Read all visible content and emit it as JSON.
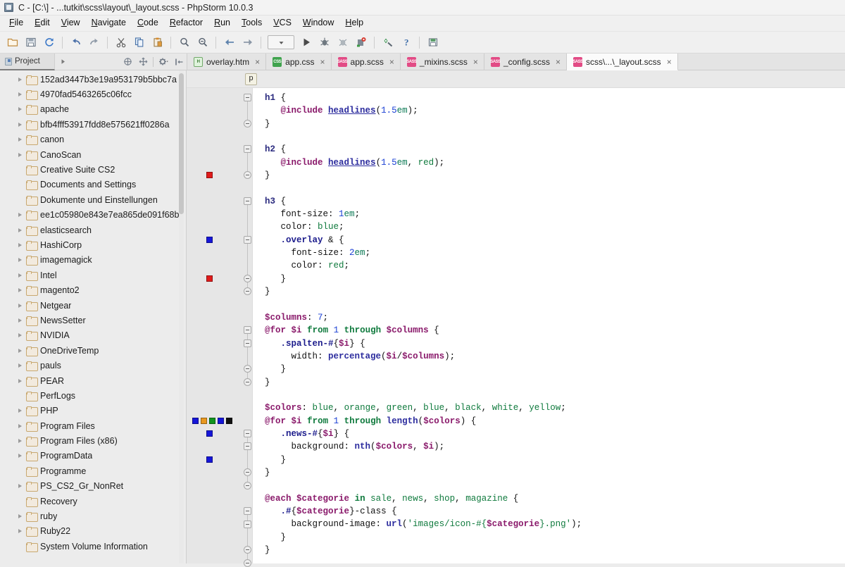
{
  "window": {
    "title": "C - [C:\\] - ...tutkit\\scss\\layout\\_layout.scss - PhpStorm 10.0.3",
    "app_icon": "phpstorm-icon"
  },
  "menubar": [
    {
      "label": "File"
    },
    {
      "label": "Edit"
    },
    {
      "label": "View"
    },
    {
      "label": "Navigate"
    },
    {
      "label": "Code"
    },
    {
      "label": "Refactor"
    },
    {
      "label": "Run"
    },
    {
      "label": "Tools"
    },
    {
      "label": "VCS"
    },
    {
      "label": "Window"
    },
    {
      "label": "Help"
    }
  ],
  "toolbar": {
    "items": [
      {
        "name": "open-icon"
      },
      {
        "name": "save-all-icon"
      },
      {
        "name": "sync-icon"
      },
      {
        "name": "undo-icon"
      },
      {
        "name": "redo-icon"
      },
      {
        "name": "cut-icon"
      },
      {
        "name": "copy-icon"
      },
      {
        "name": "paste-icon"
      },
      {
        "name": "find-icon"
      },
      {
        "name": "replace-icon"
      },
      {
        "name": "back-icon"
      },
      {
        "name": "forward-icon"
      },
      {
        "name": "run-config-dropdown"
      },
      {
        "name": "run-icon"
      },
      {
        "name": "debug-icon"
      },
      {
        "name": "coverage-icon"
      },
      {
        "name": "stop-icon"
      },
      {
        "name": "settings-icon"
      },
      {
        "name": "help-icon"
      },
      {
        "name": "database-icon"
      }
    ]
  },
  "project_button": {
    "label": "Project"
  },
  "tool_icons": [
    {
      "name": "collapse-all-icon"
    },
    {
      "name": "scroll-from-source-icon"
    },
    {
      "name": "settings-gear-icon"
    },
    {
      "name": "hide-panel-icon"
    }
  ],
  "tabs": [
    {
      "label": "overlay.htm",
      "type": "htm",
      "badge": "H",
      "active": false
    },
    {
      "label": "app.css",
      "type": "css",
      "badge": "CSS",
      "active": false
    },
    {
      "label": "app.scss",
      "type": "scss",
      "badge": "SASS",
      "active": false
    },
    {
      "label": "_mixins.scss",
      "type": "scss",
      "badge": "SASS",
      "active": false
    },
    {
      "label": "_config.scss",
      "type": "scss",
      "badge": "SASS",
      "active": false
    },
    {
      "label": "scss\\...\\_layout.scss",
      "type": "scss",
      "badge": "SASS",
      "active": true
    }
  ],
  "tab_close_glyph": "×",
  "tree": {
    "items": [
      {
        "label": "152ad3447b3e19a953179b5bbc7a",
        "expandable": true
      },
      {
        "label": "4970fad5463265c06fcc",
        "expandable": true
      },
      {
        "label": "apache",
        "expandable": true
      },
      {
        "label": "bfb4fff53917fdd8e575621ff0286a",
        "expandable": true
      },
      {
        "label": "canon",
        "expandable": true
      },
      {
        "label": "CanoScan",
        "expandable": true
      },
      {
        "label": "Creative Suite CS2",
        "expandable": false
      },
      {
        "label": "Documents and Settings",
        "expandable": false
      },
      {
        "label": "Dokumente und Einstellungen",
        "expandable": false
      },
      {
        "label": "ee1c05980e843e7ea865de091f68b",
        "expandable": true
      },
      {
        "label": "elasticsearch",
        "expandable": true
      },
      {
        "label": "HashiCorp",
        "expandable": true
      },
      {
        "label": "imagemagick",
        "expandable": true
      },
      {
        "label": "Intel",
        "expandable": true
      },
      {
        "label": "magento2",
        "expandable": true
      },
      {
        "label": "Netgear",
        "expandable": true
      },
      {
        "label": "NewsSetter",
        "expandable": true
      },
      {
        "label": "NVIDIA",
        "expandable": true
      },
      {
        "label": "OneDriveTemp",
        "expandable": true
      },
      {
        "label": "pauls",
        "expandable": true
      },
      {
        "label": "PEAR",
        "expandable": true
      },
      {
        "label": "PerfLogs",
        "expandable": false
      },
      {
        "label": "PHP",
        "expandable": true
      },
      {
        "label": "Program Files",
        "expandable": true
      },
      {
        "label": "Program Files (x86)",
        "expandable": true
      },
      {
        "label": "ProgramData",
        "expandable": true
      },
      {
        "label": "Programme",
        "expandable": false
      },
      {
        "label": "PS_CS2_Gr_NonRet",
        "expandable": true
      },
      {
        "label": "Recovery",
        "expandable": false
      },
      {
        "label": "ruby",
        "expandable": true
      },
      {
        "label": "Ruby22",
        "expandable": true
      },
      {
        "label": "System Volume Information",
        "expandable": false
      }
    ]
  },
  "editor": {
    "breadcrumb": "p",
    "gutter_swatches": [
      {
        "color": "#e01b1b",
        "line": 7
      },
      {
        "color": "#1616d8",
        "line": 12
      },
      {
        "color": "#e01b1b",
        "line": 15
      },
      {
        "color": "#1616d8",
        "line": 26
      },
      {
        "color": "#e8981e",
        "line": 26
      },
      {
        "color": "#11941f",
        "line": 26
      },
      {
        "color": "#1616d8",
        "line": 26
      },
      {
        "color": "#111111",
        "line": 26
      },
      {
        "color": "#1616d8",
        "line": 27
      },
      {
        "color": "#1616d8",
        "line": 29
      }
    ],
    "lines": [
      "h1 {",
      "   @include headlines(1.5em);",
      "}",
      "",
      "h2 {",
      "   @include headlines(1.5em, red);",
      "}",
      "",
      "h3 {",
      "   font-size: 1em;",
      "   color: blue;",
      "   .overlay & {",
      "     font-size: 2em;",
      "     color: red;",
      "   }",
      "}",
      "",
      "$columns: 7;",
      "@for $i from 1 through $columns {",
      "   .spalten-#{$i} {",
      "     width: percentage($i/$columns);",
      "   }",
      "}",
      "",
      "$colors: blue, orange, green, blue, black, white, yellow;",
      "@for $i from 1 through length($colors) {",
      "   .news-#{$i} {",
      "     background: nth($colors, $i);",
      "   }",
      "}",
      "",
      "@each $categorie in sale, news, shop, magazine {",
      "   .#{$categorie}-class {",
      "     background-image: url('images/icon-#{$categorie}.png');",
      "   }",
      "}"
    ]
  },
  "colors": {
    "chrome": "#f0f0f0",
    "tab_active": "#fbfbfb",
    "tree_bg": "#ececec",
    "editor_bg": "#ffffff",
    "gutter_bg": "#e6e6e6",
    "keyword_at": "#8a1a6b",
    "value_green": "#0f7a3d",
    "number_blue": "#1a3fd4",
    "selector_blue": "#1c1c8c"
  }
}
